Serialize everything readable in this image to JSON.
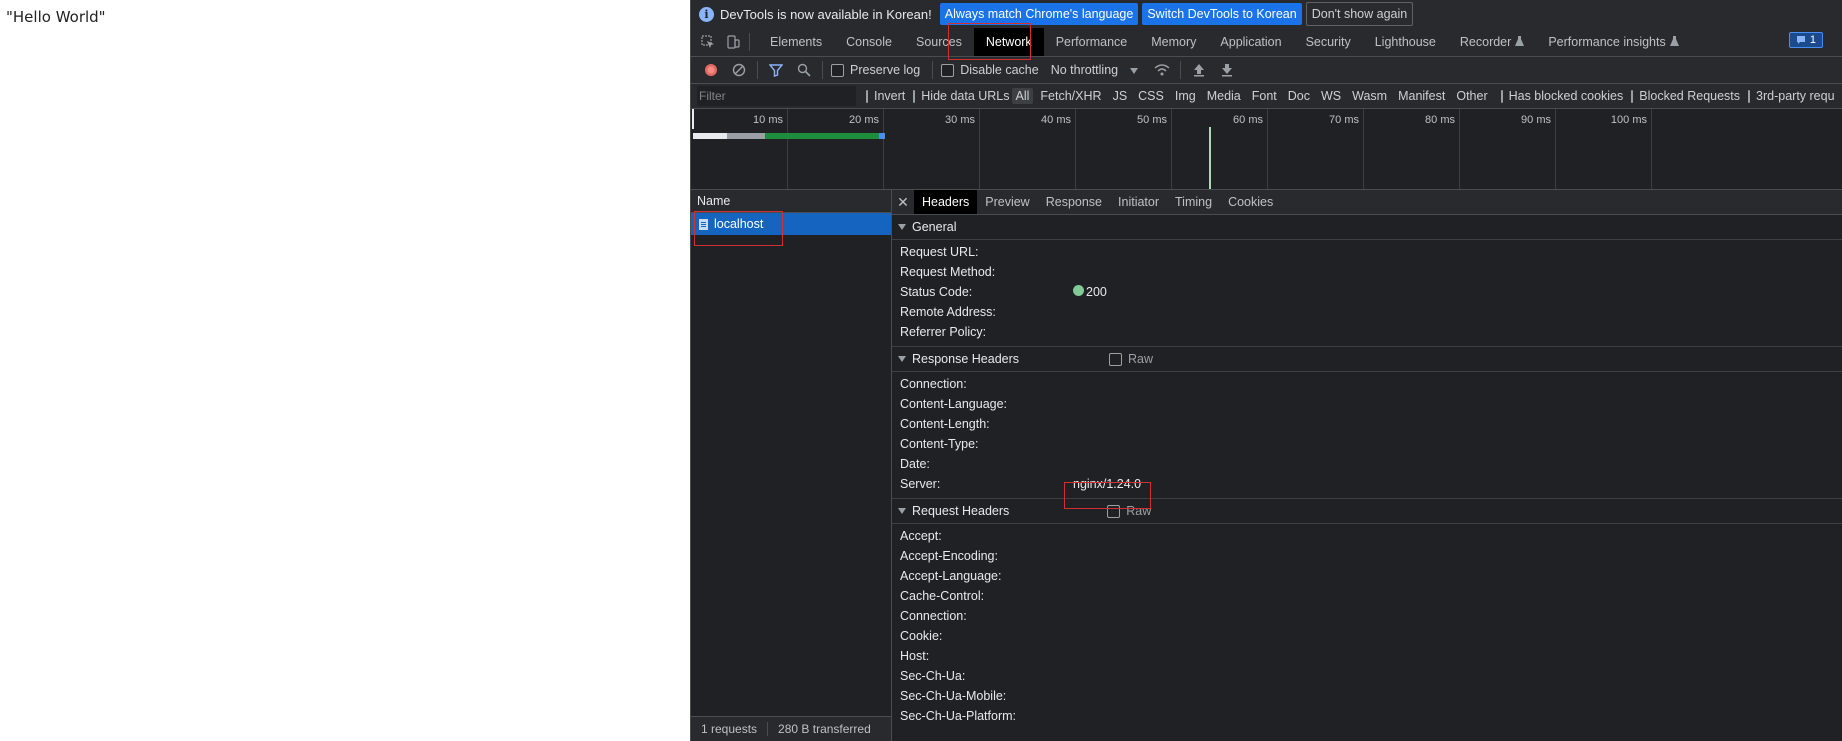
{
  "page": {
    "content_text": "\"Hello World\""
  },
  "infobar": {
    "message": "DevTools is now available in Korean!",
    "btn_match": "Always match Chrome's language",
    "btn_switch": "Switch DevTools to Korean",
    "btn_dismiss": "Don't show again"
  },
  "tabs": [
    "Elements",
    "Console",
    "Sources",
    "Network",
    "Performance",
    "Memory",
    "Application",
    "Security",
    "Lighthouse",
    "Recorder",
    "Performance insights"
  ],
  "active_tab": "Network",
  "message_count": "1",
  "toolbar": {
    "preserve_log": "Preserve log",
    "disable_cache": "Disable cache",
    "throttling": "No throttling"
  },
  "filterbar": {
    "placeholder": "Filter",
    "invert": "Invert",
    "hide_data_urls": "Hide data URLs",
    "types": [
      "All",
      "Fetch/XHR",
      "JS",
      "CSS",
      "Img",
      "Media",
      "Font",
      "Doc",
      "WS",
      "Wasm",
      "Manifest",
      "Other"
    ],
    "active_type": "All",
    "has_blocked_cookies": "Has blocked cookies",
    "blocked_requests": "Blocked Requests",
    "third_party": "3rd-party requ"
  },
  "timeline": {
    "ticks": [
      "10 ms",
      "20 ms",
      "30 ms",
      "40 ms",
      "50 ms",
      "60 ms",
      "70 ms",
      "80 ms",
      "90 ms",
      "100 ms"
    ]
  },
  "requests": {
    "column_header": "Name",
    "items": [
      "localhost"
    ],
    "status": {
      "count": "1 requests",
      "transferred": "280 B transferred"
    }
  },
  "details": {
    "tabs": [
      "Headers",
      "Preview",
      "Response",
      "Initiator",
      "Timing",
      "Cookies"
    ],
    "active_tab": "Headers",
    "general": {
      "title": "General",
      "rows": [
        {
          "key": "Request URL:",
          "value": ""
        },
        {
          "key": "Request Method:",
          "value": ""
        },
        {
          "key": "Status Code:",
          "value": "200"
        },
        {
          "key": "Remote Address:",
          "value": ""
        },
        {
          "key": "Referrer Policy:",
          "value": ""
        }
      ]
    },
    "response_headers": {
      "title": "Response Headers",
      "raw_label": "Raw",
      "rows": [
        {
          "key": "Connection:",
          "value": ""
        },
        {
          "key": "Content-Language:",
          "value": ""
        },
        {
          "key": "Content-Length:",
          "value": ""
        },
        {
          "key": "Content-Type:",
          "value": ""
        },
        {
          "key": "Date:",
          "value": ""
        },
        {
          "key": "Server:",
          "value": "nginx/1.24.0"
        }
      ]
    },
    "request_headers": {
      "title": "Request Headers",
      "raw_label": "Raw",
      "rows": [
        {
          "key": "Accept:",
          "value": ""
        },
        {
          "key": "Accept-Encoding:",
          "value": ""
        },
        {
          "key": "Accept-Language:",
          "value": ""
        },
        {
          "key": "Cache-Control:",
          "value": ""
        },
        {
          "key": "Connection:",
          "value": ""
        },
        {
          "key": "Cookie:",
          "value": ""
        },
        {
          "key": "Host:",
          "value": ""
        },
        {
          "key": "Sec-Ch-Ua:",
          "value": ""
        },
        {
          "key": "Sec-Ch-Ua-Mobile:",
          "value": ""
        },
        {
          "key": "Sec-Ch-Ua-Platform:",
          "value": ""
        }
      ]
    }
  },
  "colors": {
    "accent": "#1a73e8",
    "selected_row": "#1565c0",
    "status_ok": "#81c995",
    "highlight_box": "#d32f2f"
  }
}
